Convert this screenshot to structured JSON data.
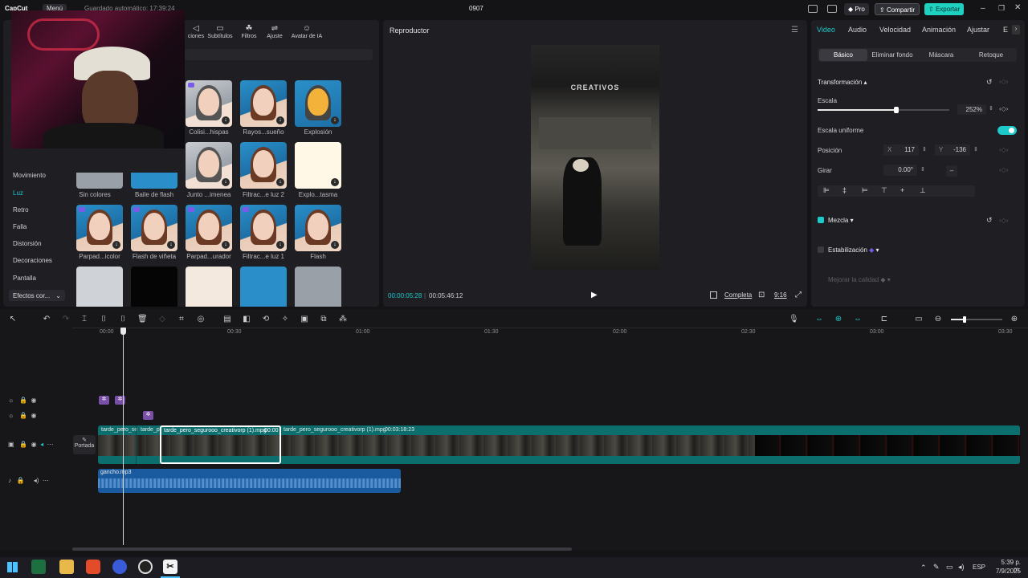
{
  "app": {
    "logo": "CapCut",
    "menu_label": "Menú",
    "autosave": "Guardado automático: 17:39:24",
    "project_name": "0907",
    "pro_label": "Pro",
    "share_label": "Compartir",
    "export_label": "Exportar"
  },
  "media_tabs": [
    "Transiciones",
    "Subtítulos",
    "Filtros",
    "Ajuste",
    "Avatar de IA"
  ],
  "media_tabs_visible": [
    "ciones",
    "Subtítulos",
    "Filtros",
    "Ajuste",
    "Avatar de IA"
  ],
  "side_categories": [
    "Movimiento",
    "Luz",
    "Retro",
    "Falla",
    "Distorsión",
    "Decoraciones",
    "Pantalla"
  ],
  "side_active": "Luz",
  "effects_dropdown": "Efectos cor...",
  "effects": [
    {
      "name": "Colisi...hispas"
    },
    {
      "name": "Rayos...sueño"
    },
    {
      "name": "Explosión"
    },
    {
      "name": "Sin colores"
    },
    {
      "name": "Baile de flash"
    },
    {
      "name": "Junto ...imenea"
    },
    {
      "name": "Filtrac...e luz 2"
    },
    {
      "name": "Explo...tasma"
    },
    {
      "name": "Parpad...icolor"
    },
    {
      "name": "Flash de viñeta"
    },
    {
      "name": "Parpad...urador"
    },
    {
      "name": "Filtrac...e luz 1"
    },
    {
      "name": "Flash"
    }
  ],
  "player": {
    "title": "Reproductor",
    "current_time": "00:00:05:28",
    "total_time": "00:05:46:12",
    "quality": "Completa",
    "ratio": "9:16",
    "video_text_top": "CREATIVOS"
  },
  "inspector": {
    "tabs": [
      "Video",
      "Audio",
      "Velocidad",
      "Animación",
      "Ajustar",
      "E"
    ],
    "active_tab": "Video",
    "subtabs": [
      "Básico",
      "Eliminar fondo",
      "Máscara",
      "Retoque"
    ],
    "active_subtab": "Básico",
    "section_transform": "Transformación",
    "scale_label": "Escala",
    "scale_value": "252%",
    "scale_level": 0.6,
    "uniform_label": "Escala uniforme",
    "position_label": "Posición",
    "pos_x_label": "X",
    "pos_x": "117",
    "pos_y_label": "Y",
    "pos_y": "-136",
    "rotate_label": "Girar",
    "rotate_value": "0.00°",
    "blend_label": "Mezcla",
    "stabilize_label": "Estabilización",
    "quality_label": "Mejorar la calidad"
  },
  "timeline": {
    "ruler": [
      "00:00",
      "00:30",
      "01:00",
      "01:30",
      "02:00",
      "02:30",
      "03:00",
      "03:30"
    ],
    "cover_label": "Portada",
    "clips": [
      {
        "label": "tarde_pero_se"
      },
      {
        "label": "tarde_p"
      },
      {
        "label": "tarde_pero_segurooo_creativorp (1).mpg",
        "time": "00:00"
      },
      {
        "label": "tarde_pero_segurooo_creativorp (1).mpg",
        "time": "00:03:18:23"
      }
    ],
    "audio_clip": "gancho.mp3"
  },
  "taskbar": {
    "lang": "ESP",
    "time": "5:39 p. m.",
    "date": "7/9/2025"
  },
  "colors": {
    "accent": "#1ec9c9",
    "export_bg": "#1ed1c1",
    "clip_teal": "#0d7d7d",
    "audio_blue": "#1a5a9e",
    "pro_purple": "#7a5ae8"
  }
}
